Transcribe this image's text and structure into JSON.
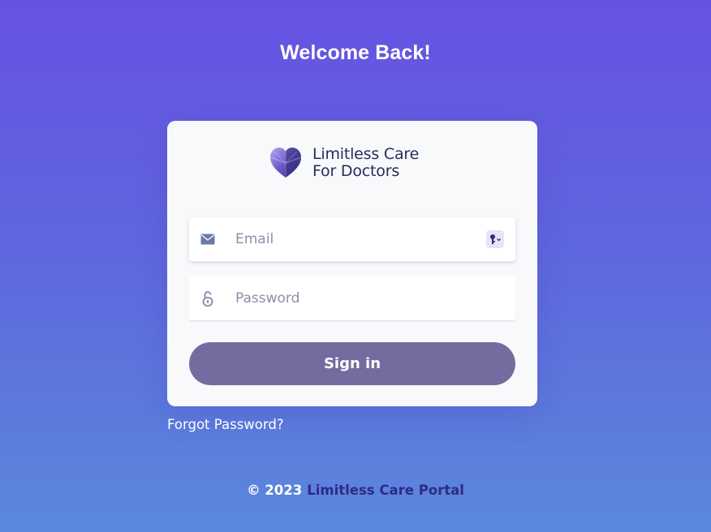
{
  "header": {
    "title": "Welcome Back!"
  },
  "logo": {
    "line1": "Limitless Care",
    "line2": "For Doctors",
    "icon": "heart-logo-icon"
  },
  "form": {
    "email": {
      "placeholder": "Email",
      "value": "",
      "icon": "envelope-icon",
      "autofill_icon": "key-icon"
    },
    "password": {
      "placeholder": "Password",
      "value": "",
      "icon": "lock-icon"
    },
    "submit_label": "Sign in"
  },
  "links": {
    "forgot_password": "Forgot Password?"
  },
  "footer": {
    "copyright": "© 2023",
    "portal_name": "Limitless Care Portal"
  },
  "colors": {
    "background_top": "#6652e2",
    "background_bottom": "#5a88dc",
    "button": "#746c9e",
    "brand_text": "#2b2a5c",
    "footer_link": "#2f2a86"
  }
}
